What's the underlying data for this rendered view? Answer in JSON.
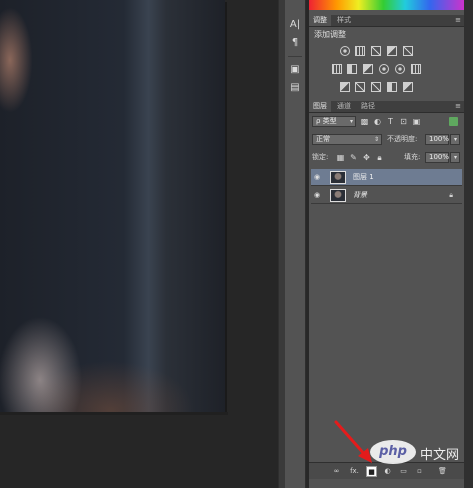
{
  "strip": {
    "buttons": [
      {
        "glyph": "A|"
      },
      {
        "glyph": "¶"
      },
      {
        "glyph": "▣"
      },
      {
        "glyph": "▤"
      }
    ]
  },
  "adjustments": {
    "tabs": [
      "调整",
      "样式"
    ],
    "title": "添加调整"
  },
  "layers": {
    "tabs": [
      "图层",
      "通道",
      "路径"
    ],
    "filter_label": "ρ 类型",
    "blend_mode": "正常",
    "opacity_label": "不透明度:",
    "opacity_value": "100%",
    "lock_label": "锁定:",
    "fill_label": "填充:",
    "fill_value": "100%",
    "items": [
      {
        "name": "图层 1",
        "selected": true,
        "locked": false
      },
      {
        "name": "背景",
        "selected": false,
        "locked": true
      }
    ],
    "footer_icons": [
      "link-layers-icon",
      "fx-icon",
      "add-layer-mask-icon",
      "adjustment-layer-icon",
      "group-icon",
      "new-layer-icon",
      "delete-layer-icon"
    ],
    "footer_fx_label": "fx."
  },
  "watermark": {
    "logo_text": "php",
    "site_text": "中文网"
  },
  "colors": {
    "panel_bg": "#535353",
    "selected_layer": "#6e7c92",
    "pointer_arrow": "#e41b1b"
  }
}
